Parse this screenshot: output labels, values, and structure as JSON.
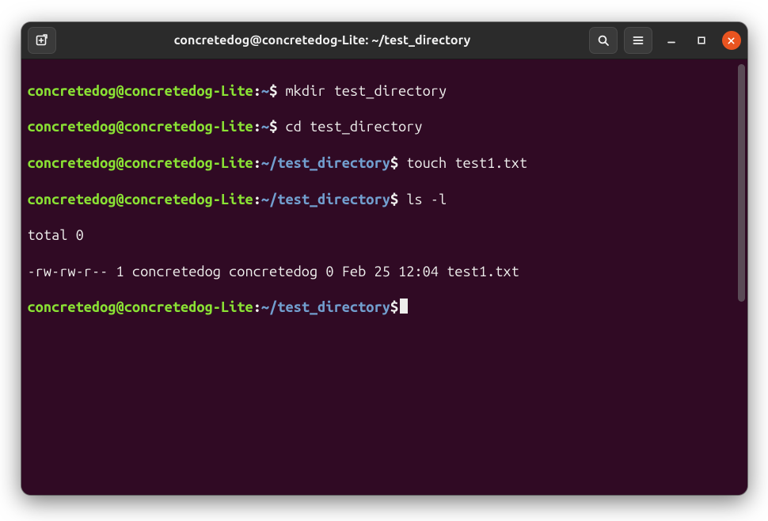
{
  "titlebar": {
    "title": "concretedog@concretedog-Lite: ~/test_directory"
  },
  "prompt": {
    "user": "concretedog",
    "at": "@",
    "host": "concretedog-Lite",
    "sep": ":",
    "home_path": "~",
    "dir_path": "~/test_directory",
    "dollar": "$"
  },
  "lines": {
    "l1_cmd": "mkdir test_directory",
    "l2_cmd": "cd test_directory",
    "l3_cmd": "touch test1.txt",
    "l4_cmd": "ls -l",
    "l5_out": "total 0",
    "l6_out": "-rw-rw-r-- 1 concretedog concretedog 0 Feb 25 12:04 test1.txt"
  },
  "icons": {
    "new_tab": "new-tab-icon",
    "search": "search-icon",
    "menu": "hamburger-icon",
    "min": "minimize-icon",
    "max": "maximize-icon",
    "close": "close-icon"
  }
}
